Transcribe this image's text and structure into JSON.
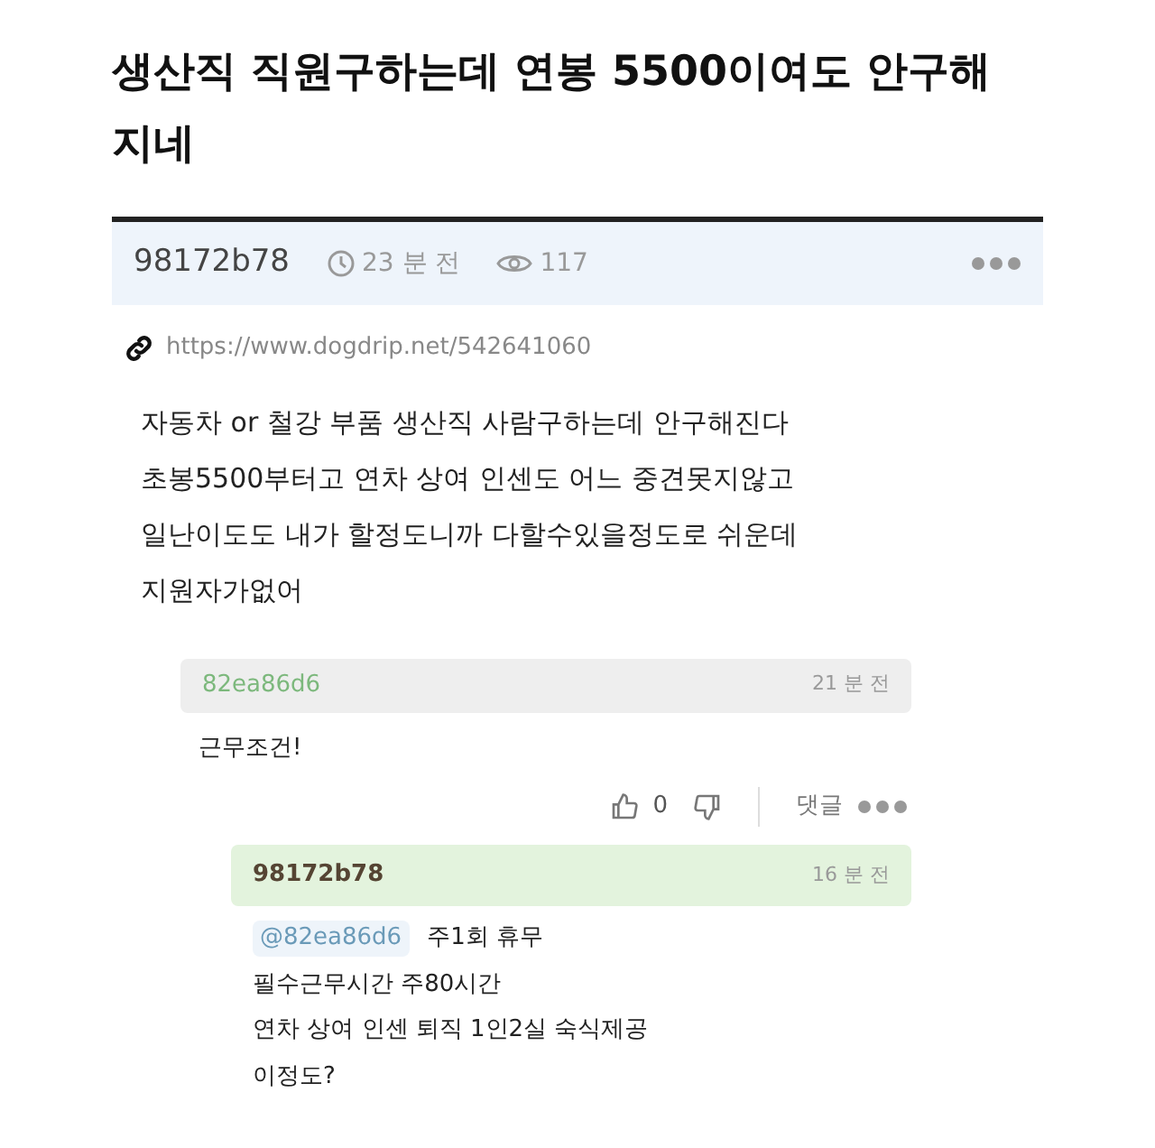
{
  "title": "생산직 직원구하는데 연봉 5500이여도 안구해지네",
  "post": {
    "author": "98172b78",
    "time": "23 분 전",
    "views": "117",
    "url": "https://www.dogdrip.net/542641060",
    "body": [
      "자동차 or 철강 부품 생산직 사람구하는데 안구해진다",
      "초봉5500부터고 연차 상여 인센도 어느 중견못지않고",
      "일난이도도 내가 할정도니까 다할수있을정도로 쉬운데",
      "지원자가없어"
    ]
  },
  "comments": [
    {
      "kind": "comment",
      "author": "82ea86d6",
      "time": "21 분 전",
      "lines": [
        "근무조건!"
      ],
      "likes": "0",
      "reply_label": "댓글"
    },
    {
      "kind": "reply",
      "author": "98172b78",
      "time": "16 분 전",
      "mention": "@82ea86d6",
      "lines": [
        "주1회 휴무",
        "필수근무시간 주80시간",
        "연차 상여 인센 퇴직 1인2실 숙식제공",
        "이정도?"
      ]
    }
  ]
}
